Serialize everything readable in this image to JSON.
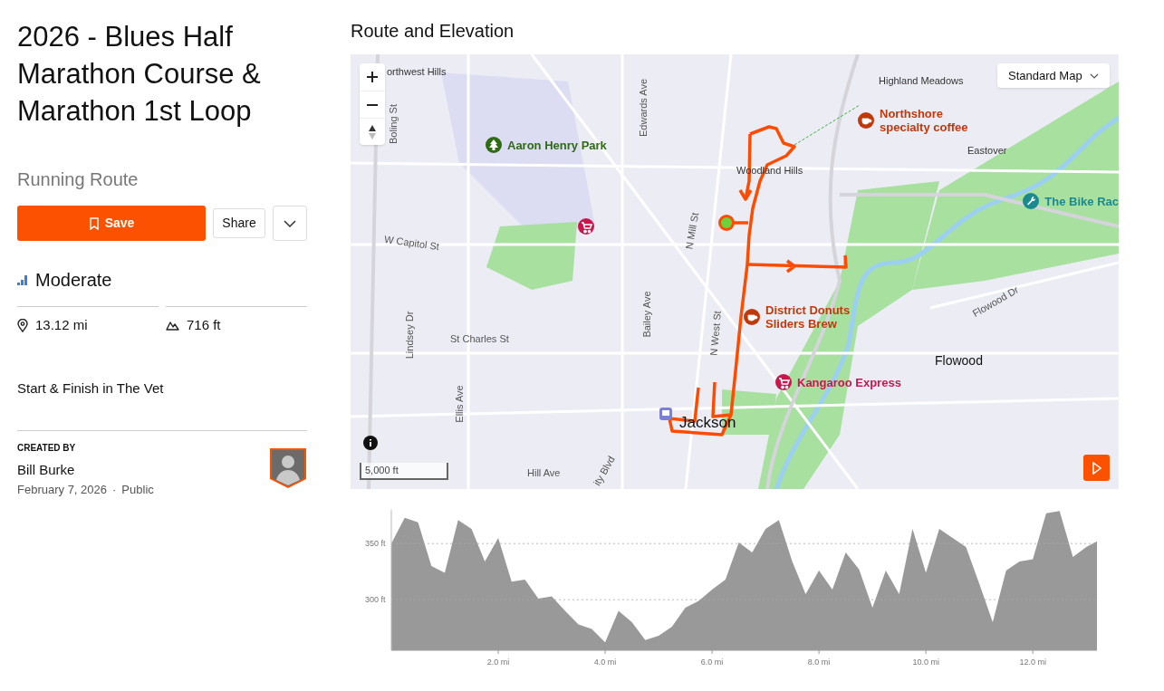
{
  "route": {
    "title": "2026 - Blues Half Marathon Course & Marathon 1st Loop",
    "type": "Running Route"
  },
  "actions": {
    "save": "Save",
    "share": "Share"
  },
  "difficulty": "Moderate",
  "stats": [
    {
      "kind": "distance",
      "value": "13.12 mi"
    },
    {
      "kind": "elevation",
      "value": "716 ft"
    }
  ],
  "description": "Start & Finish in The Vet",
  "creator": {
    "heading": "CREATED BY",
    "name": "Bill Burke",
    "date": "February 7, 2026",
    "separator": "·",
    "visibility": "Public"
  },
  "map": {
    "title": "Route and Elevation",
    "map_type": "Standard Map",
    "scale": "5,000 ft",
    "labels": [
      {
        "kind": "area",
        "text": "orthwest Hills"
      },
      {
        "kind": "area",
        "text": "Highland Meadows"
      },
      {
        "kind": "street",
        "text": "Edwards Ave"
      },
      {
        "kind": "street",
        "text": "Boling St"
      },
      {
        "kind": "poi",
        "color": "#c0390b",
        "text": "Northshore specialty coffee"
      },
      {
        "kind": "poi",
        "color": "#2e6b12",
        "text": "Aaron Henry Park"
      },
      {
        "kind": "area",
        "text": "Eastover"
      },
      {
        "kind": "area",
        "text": "Woodland Hills"
      },
      {
        "kind": "poi",
        "color": "#1b8a8f",
        "text": "The Bike Rac"
      },
      {
        "kind": "poi",
        "color": "#c8174f"
      },
      {
        "kind": "street",
        "text": "W Capitol St"
      },
      {
        "kind": "street",
        "text": "N Mill St"
      },
      {
        "kind": "street",
        "text": "Flowood Dr"
      },
      {
        "kind": "poi",
        "color": "#c0390b",
        "text": "District Donuts Sliders Brew"
      },
      {
        "kind": "street",
        "text": "Bailey Ave"
      },
      {
        "kind": "street",
        "text": "N West St"
      },
      {
        "kind": "street",
        "text": "Lindsey Dr"
      },
      {
        "kind": "street",
        "text": "St Charles St"
      },
      {
        "kind": "city",
        "text": "Flowood"
      },
      {
        "kind": "poi",
        "color": "#c8174f",
        "text": "Kangaroo Express"
      },
      {
        "kind": "street",
        "text": "Ellis Ave"
      },
      {
        "kind": "city",
        "text": "Jackson"
      },
      {
        "kind": "street",
        "text": "Hill Ave"
      },
      {
        "kind": "street",
        "text": "ity Blvd"
      }
    ]
  },
  "elevation": {
    "chart_data": {
      "type": "area",
      "xlim": [
        0,
        13.2
      ],
      "ylim": [
        255,
        380
      ],
      "xticks": [
        {
          "value": 2,
          "label": "2.0 mi"
        },
        {
          "value": 4,
          "label": "4.0 mi"
        },
        {
          "value": 6,
          "label": "6.0 mi"
        },
        {
          "value": 8,
          "label": "8.0 mi"
        },
        {
          "value": 10,
          "label": "10.0 mi"
        },
        {
          "value": 12,
          "label": "12.0 mi"
        }
      ],
      "yticks": [
        {
          "value": 300,
          "label": "300 ft"
        },
        {
          "value": 350,
          "label": "350 ft"
        }
      ],
      "x": [
        0,
        0.25,
        0.5,
        0.75,
        1,
        1.25,
        1.5,
        1.75,
        2,
        2.25,
        2.5,
        2.75,
        3,
        3.25,
        3.5,
        3.75,
        4,
        4.25,
        4.5,
        4.75,
        5,
        5.25,
        5.5,
        5.75,
        6,
        6.25,
        6.5,
        6.75,
        7,
        7.25,
        7.5,
        7.75,
        8,
        8.25,
        8.5,
        8.75,
        9,
        9.25,
        9.5,
        9.75,
        10,
        10.25,
        10.5,
        10.75,
        11,
        11.25,
        11.5,
        11.75,
        12,
        12.25,
        12.5,
        12.75,
        13,
        13.2
      ],
      "series": [
        {
          "color": "#999999",
          "values": [
            350,
            373,
            369,
            330,
            324,
            371,
            363,
            334,
            355,
            316,
            318,
            301,
            303,
            290,
            278,
            274,
            262,
            290,
            280,
            264,
            268,
            276,
            293,
            299,
            309,
            318,
            351,
            342,
            363,
            371,
            334,
            305,
            326,
            309,
            342,
            327,
            293,
            326,
            305,
            363,
            324,
            363,
            355,
            347,
            314,
            280,
            326,
            334,
            336,
            377,
            379,
            338,
            347,
            352
          ]
        }
      ]
    }
  }
}
